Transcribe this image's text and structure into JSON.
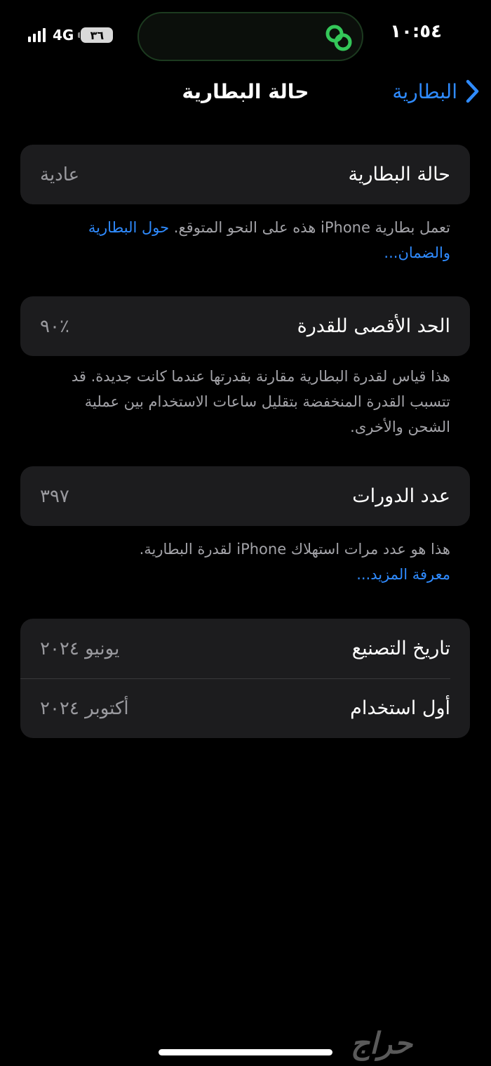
{
  "status_bar": {
    "time": "١٠:٥٤",
    "network": "4G",
    "battery": "٣٦"
  },
  "nav": {
    "back_label": "البطارية",
    "title": "حالة البطارية"
  },
  "battery_condition": {
    "label": "حالة البطارية",
    "value": "عادية",
    "note": "تعمل بطارية iPhone هذه على النحو المتوقع.",
    "note_link": "حول البطارية والضمان..."
  },
  "maximum_capacity": {
    "label": "الحد الأقصى للقدرة",
    "value": "٪٩٠",
    "note": "هذا قياس لقدرة البطارية مقارنة بقدرتها عندما كانت جديدة. قد تتسبب القدرة المنخفضة بتقليل ساعات الاستخدام بين عملية الشحن والأخرى."
  },
  "cycle_count": {
    "label": "عدد الدورات",
    "value": "٣٩٧",
    "note": "هذا هو عدد مرات استهلاك iPhone لقدرة البطارية.",
    "note_link": "معرفة المزيد..."
  },
  "dates": [
    {
      "label": "تاريخ التصنيع",
      "value": "يونيو ٢٠٢٤"
    },
    {
      "label": "أول استخدام",
      "value": "أكتوبر ٢٠٢٤"
    }
  ],
  "watermark": "حراج",
  "colors": {
    "background": "#000000",
    "card": "#1c1c1e",
    "link": "#2f8bff",
    "secondary_text": "#9a9a9f",
    "island_icon": "#34c759"
  }
}
